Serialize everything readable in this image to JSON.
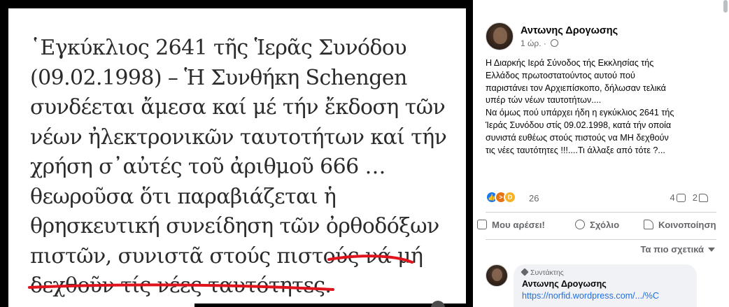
{
  "image_quote": {
    "lines": [
      "῾Εγκύκλιος 2641 τῆς Ἱερᾶς Συνόδου",
      "(09.02.1998) – Ἡ Συνθήκη Schengen",
      "συνδέεται ἄμεσα καί μέ τήν ἔκδοση τῶν",
      "νέων ἠλεκτρονικῶν ταυτοτήτων καί τήν",
      "χρήση σ᾿αὐτές τοῦ ἀριθμοῦ 666 …",
      "θεωροῦσα ὅτι παραβιάζεται ἡ",
      "θρησκευτική συνείδηση τῶν ὀρθοδόξων",
      "πιστῶν, συνιστᾶ στούς πιστούς νά μή",
      "δεχθοῦν τίς νέες ταυτότητες."
    ],
    "underline_color": "#e0141c"
  },
  "post": {
    "author": "Αντωνης Δρογωσης",
    "time": "1 ώρ.",
    "text_lines": [
      "Η Διαρκής Ιερά Σύνοδος τής Εκκλησίας τής",
      "Ελλάδος πρωτοστατούντος αυτού πού",
      "παριστάνει τον Αρχιεπίσκοπο, δήλωσαν τελικά",
      "υπέρ τών νέων ταυτοτήτων....",
      "Να όμως πού υπάρχει ήδη η εγκύκλιος 2641 τής",
      "Ίεράς Συνόδου στίς 09.02.1998, κατά τήν οποία",
      "συνιστά ευθέως στούς πιστούς να ΜΗ δεχθούν",
      "τις νέες ταυτότητες !!!....Τι άλλαξε από τότε ?..."
    ],
    "reactions": {
      "icons": [
        "like-emoji",
        "angry-emoji",
        "haha-emoji"
      ],
      "count": "26"
    },
    "comments_count": "4",
    "shares_count": "2"
  },
  "actions": {
    "like": "Μου αρέσει!",
    "comment": "Σχόλιο",
    "share": "Κοινοποίηση"
  },
  "sort_label": "Τα πιο σχετικά",
  "comment": {
    "badge": "Συντάκτης",
    "author": "Αντωνης Δρογωσης",
    "link": "https://norfid.wordpress.com/.../%C"
  },
  "colors": {
    "link": "#216fdb",
    "secondary_text": "#65676b",
    "like_blue": "#1877f2"
  }
}
